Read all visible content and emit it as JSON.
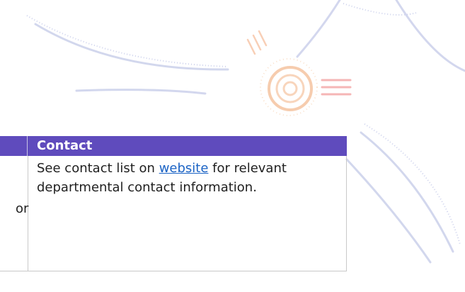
{
  "table": {
    "header": {
      "contact": "Contact"
    },
    "row": {
      "cut_text": "or",
      "contact_before": "See contact list on ",
      "contact_link": "website",
      "contact_after": " for relevant departmental contact information."
    }
  },
  "colors": {
    "header_bg": "#5f4bbd",
    "link": "#1b63c5",
    "watermark_orange": "#f3a56a",
    "watermark_red": "#ef7a7a",
    "watermark_blue": "#9ca6d6"
  },
  "icons": {
    "watermark": "aboriginal-dot-art-watermark"
  }
}
